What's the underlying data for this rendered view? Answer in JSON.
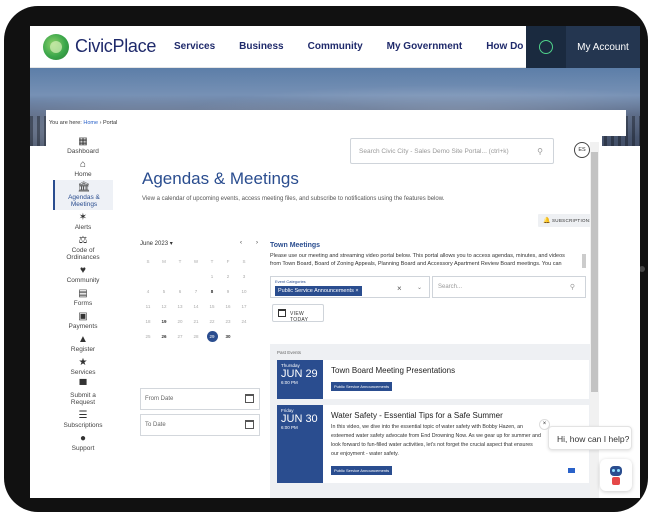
{
  "header": {
    "logo_text": "CivicPlace",
    "nav": [
      "Services",
      "Business",
      "Community",
      "My Government",
      "How Do I"
    ],
    "account_label": "My Account",
    "icons": {
      "logo": "civicplace-logo",
      "account": "user-circle-icon"
    },
    "colors": {
      "primary": "#2a4d8f",
      "account_bg": "#243650",
      "account_icon": "#4fd18a"
    }
  },
  "breadcrumb": {
    "prefix": "You are here:",
    "home": "Home",
    "separator": "›",
    "current": "Portal"
  },
  "sidebar": {
    "items": [
      {
        "label": "Dashboard",
        "icon": "dashboard-icon"
      },
      {
        "label": "Home",
        "icon": "home-icon"
      },
      {
        "label": "Agendas &",
        "label2": "Meetings",
        "icon": "building-icon",
        "active": true
      },
      {
        "label": "Alerts",
        "icon": "alert-icon"
      },
      {
        "label": "Code of",
        "label2": "Ordinances",
        "icon": "scales-icon"
      },
      {
        "label": "Community",
        "icon": "heart-hand-icon"
      },
      {
        "label": "Forms",
        "icon": "form-icon"
      },
      {
        "label": "Payments",
        "icon": "payment-icon"
      },
      {
        "label": "Register",
        "icon": "register-icon"
      },
      {
        "label": "Services",
        "icon": "services-icon"
      },
      {
        "label": "Submit a",
        "label2": "Request",
        "icon": "chat-icon"
      },
      {
        "label": "Subscriptions",
        "icon": "list-icon"
      },
      {
        "label": "Support",
        "icon": "info-icon"
      }
    ]
  },
  "search": {
    "placeholder": "Search Civic City - Sales Demo Site Portal... (ctrl+k)"
  },
  "lang_button": "ES",
  "page": {
    "title": "Agendas & Meetings",
    "subtitle": "View a calendar of upcoming events, access meeting files, and subscribe to notifications using the features below.",
    "subscriptions_label": "SUBSCRIPTIONS"
  },
  "calendar": {
    "month_label": "June 2023",
    "dropdown": "▾",
    "prev": "‹",
    "next": "›",
    "weekdays": [
      "S",
      "M",
      "T",
      "W",
      "T",
      "F",
      "S"
    ],
    "weeks": [
      [
        "",
        "",
        "",
        "",
        "1",
        "2",
        "3"
      ],
      [
        "4",
        "5",
        "6",
        "7",
        "8",
        "9",
        "10"
      ],
      [
        "11",
        "12",
        "13",
        "14",
        "15",
        "16",
        "17"
      ],
      [
        "18",
        "19",
        "20",
        "21",
        "22",
        "23",
        "24"
      ],
      [
        "25",
        "26",
        "27",
        "28",
        "29",
        "30",
        ""
      ]
    ],
    "bold_days": [
      "8",
      "19",
      "26",
      "30"
    ],
    "selected_day": "29"
  },
  "from_date": "From Date",
  "to_date": "To Date",
  "town_meetings": {
    "title": "Town Meetings",
    "description": "Please use our meeting and streaming video portal below. This portal allows you to access agendas, minutes, and videos from Town Board, Board of Zoning Appeals, Planning Board and Accessory Apartment Review Board meetings. You can",
    "filter_label": "Event Categories",
    "filter_chip": "Public Service Announcements ×",
    "filter_clear": "×",
    "filter_chevron": "⌄",
    "search_placeholder": "Search...",
    "view_today": "VIEW TODAY"
  },
  "past_events": {
    "label": "Past Events",
    "items": [
      {
        "weekday": "Thursday",
        "date": "JUN 29",
        "time": "6:00 PM",
        "title": "Town Board Meeting Presentations",
        "text": "",
        "tag": "Public Service Announcements"
      },
      {
        "weekday": "Friday",
        "date": "JUN 30",
        "time": "6:00 PM",
        "title": "Water Safety - Essential Tips for a Safe Summer",
        "text": "In this video, we dive into the essential topic of water safety with Bobby Hazen, an esteemed water safety advocate from End Drowning Now. As we gear up for summer and look forward to fun-filled water activities, let's not forget the crucial aspect that ensures our enjoyment - water safety.",
        "tag": "Public Service Announcements"
      }
    ]
  },
  "chat": {
    "close": "×",
    "bubble": "Hi, how can I help?"
  }
}
